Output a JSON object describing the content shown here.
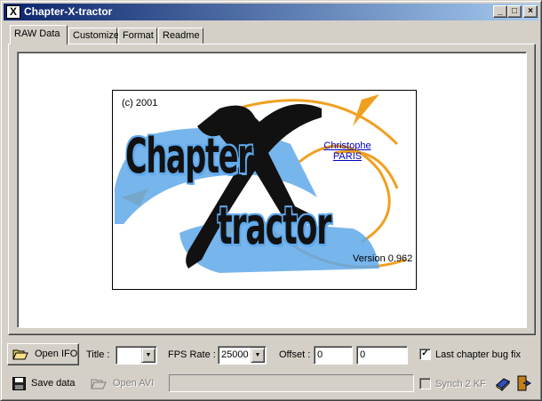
{
  "window": {
    "title": "Chapter-X-tractor",
    "icon": "app-icon",
    "controls": {
      "minimize": "_",
      "maximize": "□",
      "close": "×"
    }
  },
  "tabs": [
    {
      "label": "RAW Data",
      "active": true
    },
    {
      "label": "Customize",
      "active": false
    },
    {
      "label": "Format",
      "active": false
    },
    {
      "label": "Readme",
      "active": false
    }
  ],
  "splash": {
    "copyright": "(c) 2001",
    "logo_word1": "Chapter",
    "logo_x": "X",
    "logo_word2": "tractor",
    "author_first": "Christophe",
    "author_last": "PARIS",
    "version": "Version 0.962",
    "colors": {
      "accent_blue": "#5fa8ea",
      "arc_orange": "#f0a020"
    }
  },
  "toolbar": {
    "open_ifo": {
      "label": "Open IFO",
      "icon": "folder-open-icon"
    },
    "title_label": "Title :",
    "title_value": "",
    "fps_label": "FPS Rate :",
    "fps_value": "25000",
    "offset_label": "Offset :",
    "offset_value_1": "0",
    "offset_value_2": "0",
    "last_chapter_fix": {
      "label": "Last chapter bug fix",
      "checked": true,
      "check_glyph": "✓"
    },
    "save_data": {
      "label": "Save data",
      "icon": "floppy-disk-icon"
    },
    "open_avi": {
      "label": "Open AVI",
      "icon": "folder-open-icon",
      "enabled": false
    },
    "synch_kf": {
      "label": "Synch 2 KF",
      "checked": false,
      "enabled": false
    },
    "dropdown_glyph": "▼",
    "about_icon": "book-icon",
    "exit_icon": "exit-door-icon"
  }
}
